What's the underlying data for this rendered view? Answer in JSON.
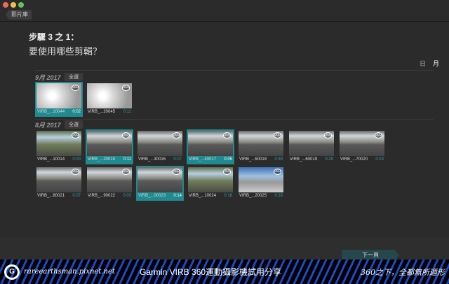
{
  "window": {
    "back_label": "影片庫",
    "colors": {
      "close": "#ed6a5e",
      "min": "#f5bf4f",
      "max": "#61c554"
    }
  },
  "header": {
    "step": "步驟 3 之 1：",
    "question": "要使用哪些剪輯？"
  },
  "view_toggle": {
    "day": "日",
    "month": "月"
  },
  "groups": [
    {
      "label": "9月 2017",
      "select_all": "全選",
      "clips": [
        {
          "name": "VIRB_...10044",
          "duration": "0:02",
          "selected": true,
          "scene": "indoor"
        },
        {
          "name": "VIRB_...20045",
          "duration": "0:11",
          "selected": false,
          "scene": "indoor"
        }
      ]
    },
    {
      "label": "8月 2017",
      "select_all": "全選",
      "clips": [
        {
          "name": "VIRB_...10014",
          "duration": "0:00",
          "selected": false,
          "scene": "park"
        },
        {
          "name": "VIRB_...20015",
          "duration": "0:11",
          "selected": true,
          "scene": "street"
        },
        {
          "name": "VIRB_...30016",
          "duration": "0:07",
          "selected": false,
          "scene": "street"
        },
        {
          "name": "VIRB_...40017",
          "duration": "0:05",
          "selected": true,
          "scene": "street"
        },
        {
          "name": "VIRB_...50018",
          "duration": "0:39",
          "selected": false,
          "scene": "street"
        },
        {
          "name": "VIRB_...60019",
          "duration": "0:29",
          "selected": false,
          "scene": "street"
        },
        {
          "name": "VIRB_...70020",
          "duration": "0:23",
          "selected": false,
          "scene": "street"
        },
        {
          "name": "VIRB_...80021",
          "duration": "0:07",
          "selected": false,
          "scene": "street"
        },
        {
          "name": "VIRB_...90022",
          "duration": "0:03",
          "selected": false,
          "scene": "street"
        },
        {
          "name": "VIRB_...00023",
          "duration": "0:14",
          "selected": true,
          "scene": "street"
        },
        {
          "name": "VIRB_...10024",
          "duration": "0:16",
          "selected": false,
          "scene": "park"
        },
        {
          "name": "VIRB_...20025",
          "duration": "0:18",
          "selected": false,
          "scene": "sky"
        }
      ]
    }
  ],
  "badge_360": "360",
  "footer": {
    "next_label": "下一頁"
  },
  "banner": {
    "logo": "G",
    "site": "rareearthsman.pixnet.net",
    "title": "Garmin VIRB 360運動攝影機試用分享",
    "slogan": "360之下，全都無所遁形"
  }
}
